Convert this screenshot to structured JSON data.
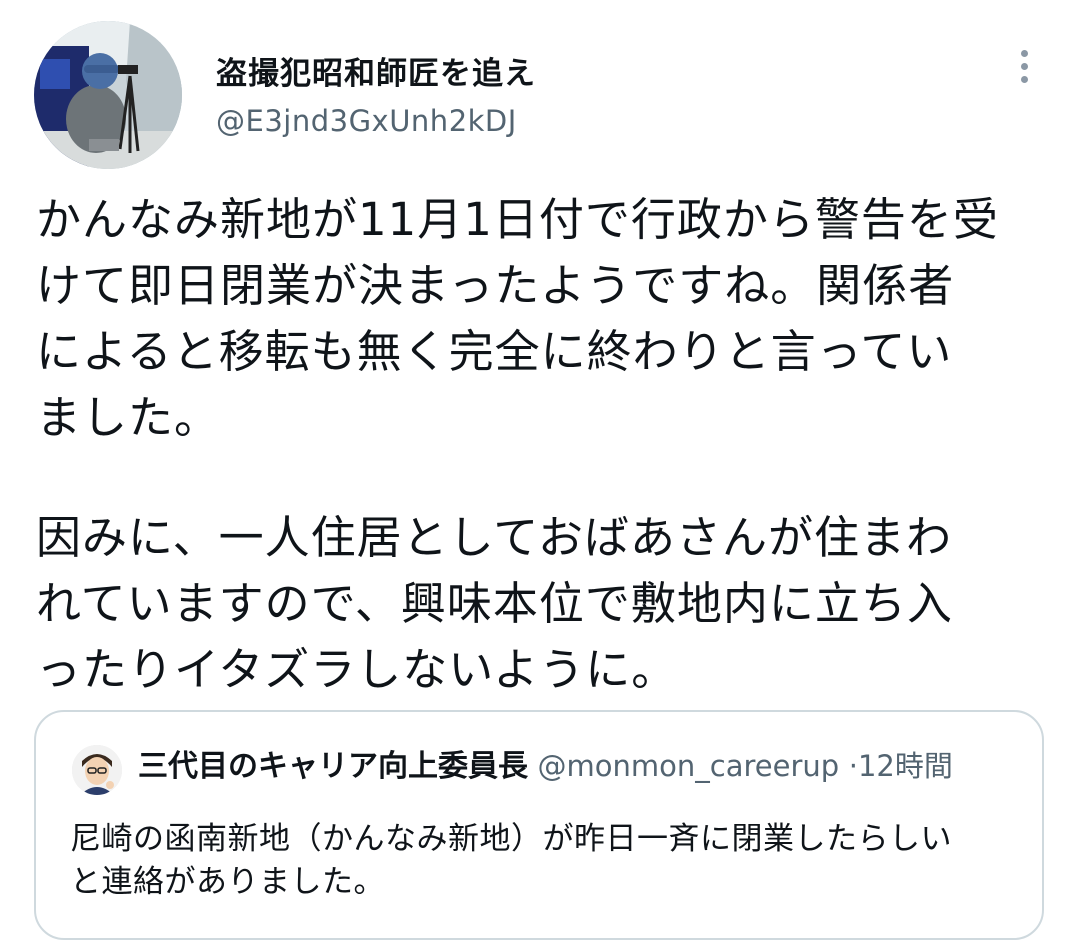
{
  "author": {
    "display_name": "盗撮犯昭和師匠を追え",
    "handle": "@E3jnd3GxUnh2kDJ"
  },
  "tweet": {
    "lines": [
      "かんなみ新地が11月1日付で行政から警告を受",
      "けて即日閉業が決まったようですね。関係者",
      "によると移転も無く完全に終わりと言ってい",
      "ました。",
      "因みに、一人住居としておばあさんが住まわ",
      "れていますので、興味本位で敷地内に立ち入",
      "ったりイタズラしないように。"
    ]
  },
  "quoted_tweet": {
    "display_name": "三代目のキャリア向上委員長",
    "handle": "@monmon_careerup",
    "separator": "·",
    "time": "12時間",
    "lines": [
      "尼崎の函南新地（かんなみ新地）が昨日一斉に閉業したらしい",
      "と連絡がありました。"
    ]
  },
  "icons": {
    "more": "more-vertical-icon"
  },
  "colors": {
    "text_primary": "#0f1419",
    "text_secondary": "#536471",
    "border": "#cfd9de"
  }
}
